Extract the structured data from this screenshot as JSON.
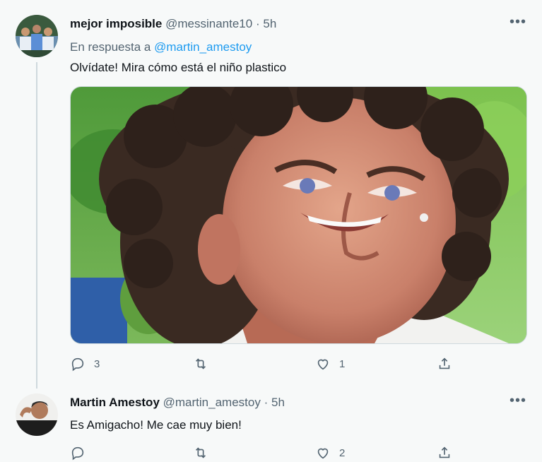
{
  "tweets": [
    {
      "name": "mejor imposible",
      "handle": "@messinante10",
      "separator": "·",
      "time": "5h",
      "reply_prefix": "En respuesta a",
      "reply_mention": "@martin_amestoy",
      "text": "Olvídate! Mira cómo está el niño plastico",
      "media_description": "Close-up photo of a smiling man with curly dark hair",
      "replies": "3",
      "retweets": "",
      "likes": "1",
      "more_icon": "more-icon"
    },
    {
      "name": "Martin Amestoy",
      "handle": "@martin_amestoy",
      "separator": "·",
      "time": "5h",
      "text": "Es Amigacho! Me cae muy bien!",
      "replies": "",
      "retweets": "",
      "likes": "2",
      "more_icon": "more-icon"
    }
  ],
  "colors": {
    "background": "#f7f9f9",
    "text": "#0f1419",
    "secondary": "#536471",
    "link": "#1d9bf0"
  }
}
